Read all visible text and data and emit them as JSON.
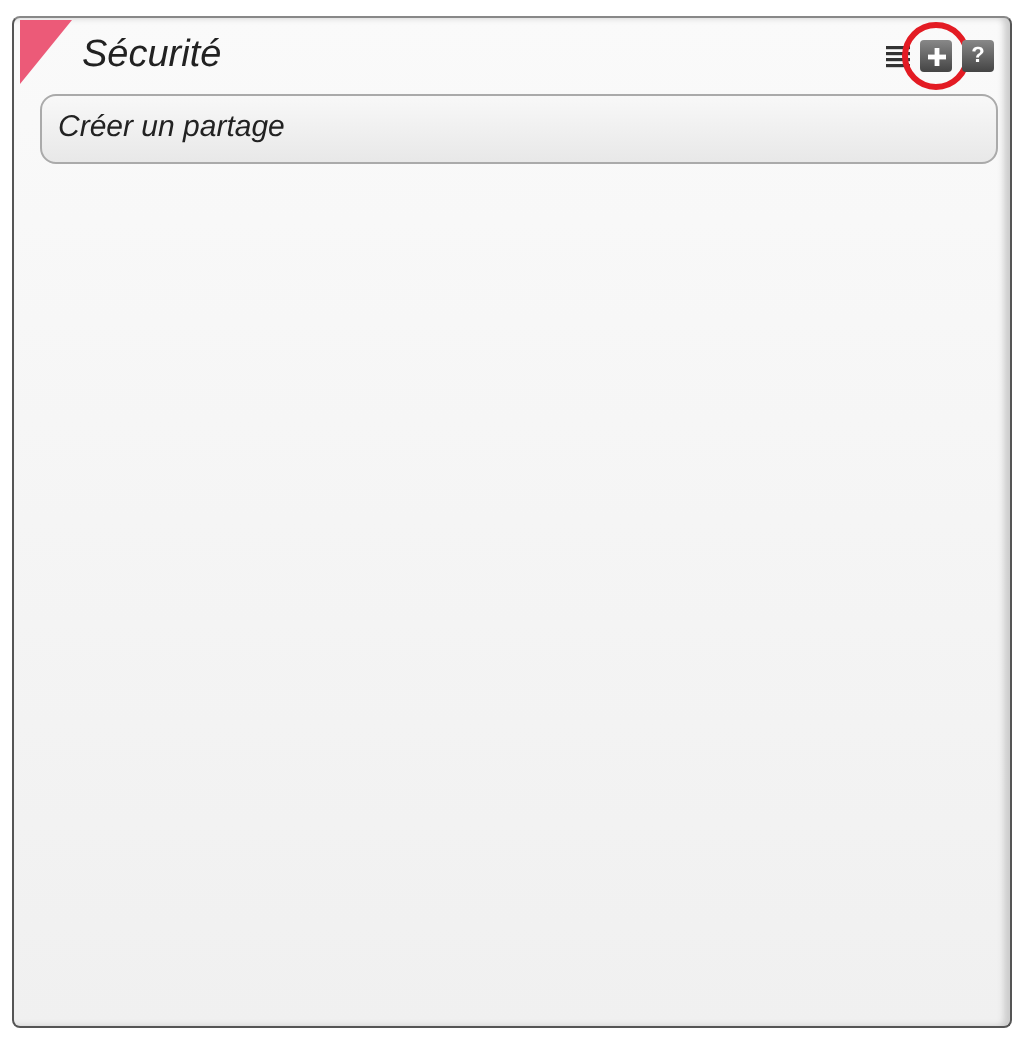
{
  "widget": {
    "title": "Sécurité",
    "toolbar": [
      {
        "kind": "list"
      },
      {
        "kind": "add",
        "highlighted": true
      },
      {
        "kind": "help",
        "label": "?",
        "highlighted": false
      }
    ]
  },
  "items": [
    {
      "label": "Créer un partage"
    }
  ]
}
